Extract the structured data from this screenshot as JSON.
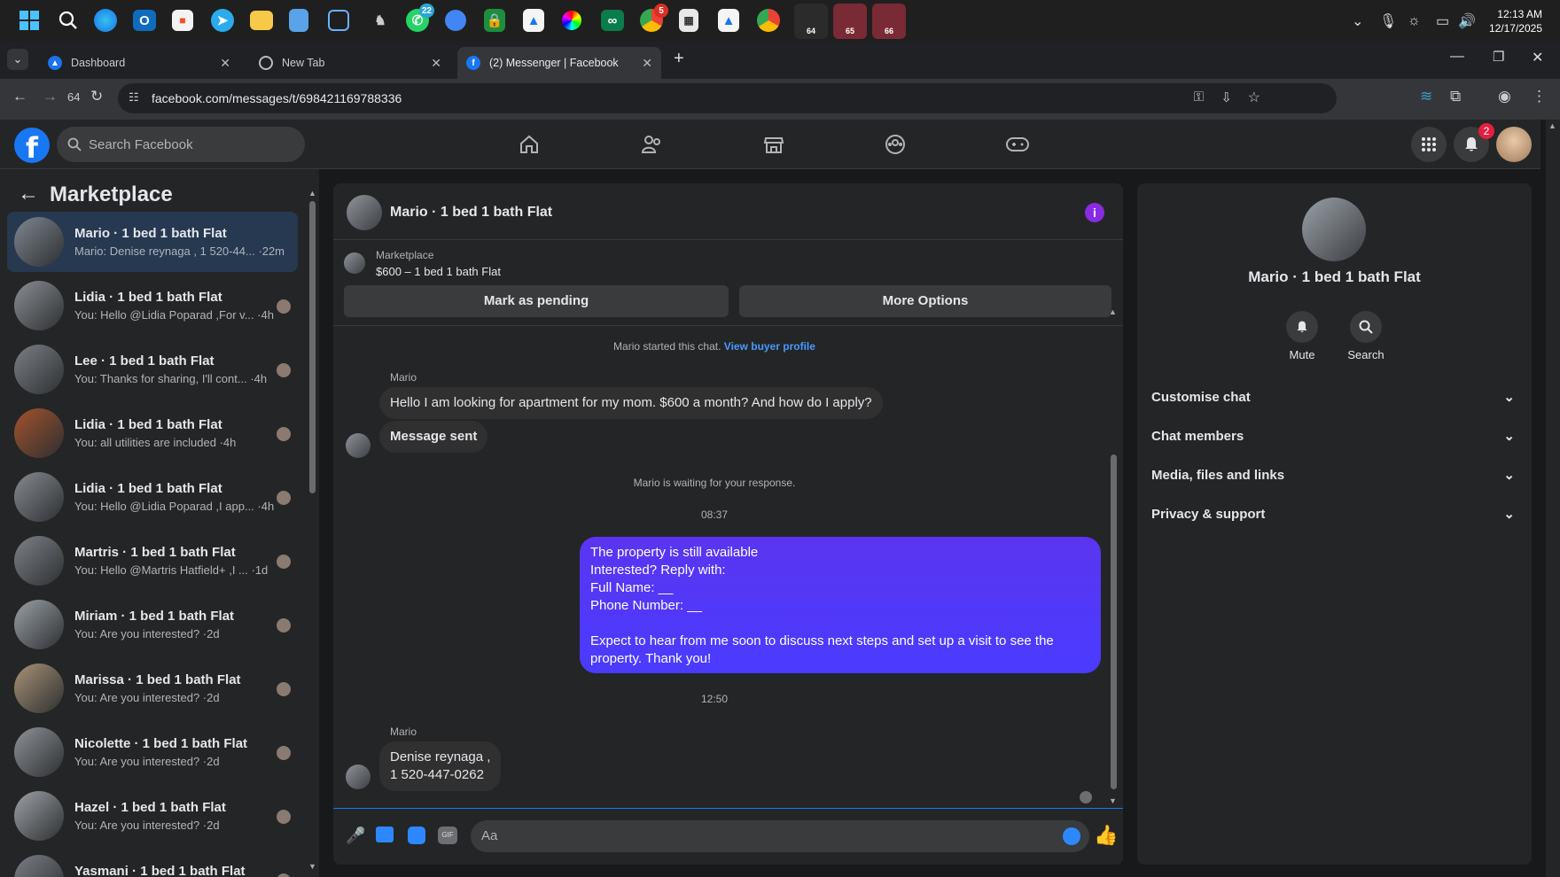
{
  "taskbar": {
    "icons": [
      "windows-start",
      "search",
      "edge",
      "outlook",
      "store",
      "telegram",
      "file-explorer",
      "notepad",
      "code",
      "game",
      "whatsapp",
      "chrome-remote",
      "lock",
      "sail",
      "color",
      "infinity",
      "chrome",
      "calculator",
      "sail-2",
      "chrome-2",
      "profile-64",
      "profile-65",
      "profile-66"
    ],
    "whatsapp_badge": "22",
    "chrome_badge": "5",
    "profile_labels": [
      "64",
      "65",
      "66"
    ],
    "time": "12:13 AM",
    "date": "12/17/2025"
  },
  "browser": {
    "tabs": [
      {
        "title": "Dashboard"
      },
      {
        "title": "New Tab"
      },
      {
        "title": "(2) Messenger | Facebook"
      }
    ],
    "profile_number": "64",
    "url": "facebook.com/messages/t/698421169788336"
  },
  "fb": {
    "search_placeholder": "Search Facebook",
    "notification_count": "2"
  },
  "marketplace": {
    "title": "Marketplace",
    "conversations": [
      {
        "name": "Mario · 1 bed 1 bath Flat",
        "snippet": "Mario: Denise reynaga , 1 520-44... ·22m",
        "active": true
      },
      {
        "name": "Lidia · 1 bed 1 bath Flat",
        "snippet": "You: Hello @Lidia Poparad ,For v... ·4h"
      },
      {
        "name": "Lee · 1 bed 1 bath Flat",
        "snippet": "You: Thanks for sharing, I'll cont... ·4h"
      },
      {
        "name": "Lidia · 1 bed 1 bath Flat",
        "snippet": "You: all utilities are included ·4h"
      },
      {
        "name": "Lidia · 1 bed 1 bath Flat",
        "snippet": "You: Hello @Lidia Poparad ,I app... ·4h"
      },
      {
        "name": "Martris · 1 bed 1 bath Flat",
        "snippet": "You: Hello @Martris Hatfield+ ,I ... ·1d"
      },
      {
        "name": "Miriam · 1 bed 1 bath Flat",
        "snippet": "You: Are you interested? ·2d"
      },
      {
        "name": "Marissa · 1 bed 1 bath Flat",
        "snippet": "You: Are you interested? ·2d"
      },
      {
        "name": "Nicolette · 1 bed 1 bath Flat",
        "snippet": "You: Are you interested? ·2d"
      },
      {
        "name": "Hazel · 1 bed 1 bath Flat",
        "snippet": "You: Are you interested? ·2d"
      },
      {
        "name": "Yasmani · 1 bed 1 bath Flat",
        "snippet": ""
      }
    ]
  },
  "chat": {
    "title": "Mario · 1 bed 1 bath Flat",
    "listing_source": "Marketplace",
    "listing_title": "$600 – 1 bed 1 bath Flat",
    "mark_pending": "Mark as pending",
    "more_options": "More Options",
    "started_note": "Mario started this chat.",
    "view_profile": "View buyer profile",
    "sender1": "Mario",
    "msg1": "Hello I am looking for apartment for my mom. $600 a month? And how do I apply?",
    "msg2": "Message sent",
    "waiting_note": "Mario is waiting for your response.",
    "time1": "08:37",
    "out_msg": "The property is still available\nInterested? Reply with:\nFull Name: __\nPhone Number: __\n\nExpect to hear from me soon to discuss next steps and set up a visit to see the property. Thank you!",
    "time2": "12:50",
    "sender2": "Mario",
    "msg3_line1": "Denise reynaga ,",
    "msg3_line2": "1 520-447-0262",
    "composer_placeholder": "Aa"
  },
  "details": {
    "name": "Mario · 1 bed 1 bath Flat",
    "mute": "Mute",
    "search": "Search",
    "sections": [
      "Customise chat",
      "Chat members",
      "Media, files and links",
      "Privacy & support"
    ]
  },
  "colors": {
    "accent": "#1877f2",
    "purple": "#8a2be2",
    "out_bubble": "#4a3bff"
  }
}
